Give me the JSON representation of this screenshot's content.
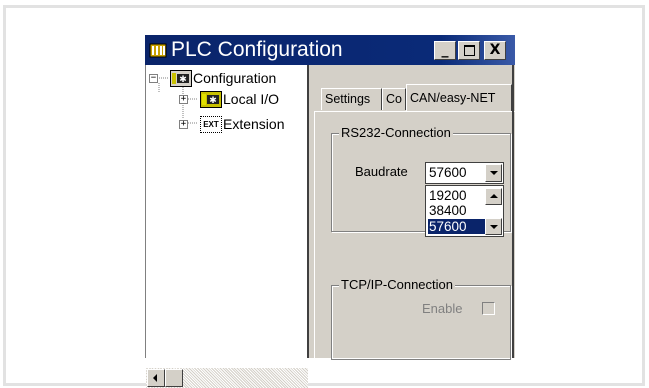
{
  "window": {
    "title": "PLC Configuration",
    "minimize_label": "_",
    "maximize_label": "□",
    "close_label": "X"
  },
  "tree": {
    "items": [
      {
        "label": "Configuration",
        "icon": "configuration-icon",
        "expander": "−"
      },
      {
        "label": "Local I/O",
        "icon": "local-io-icon",
        "expander": "+"
      },
      {
        "label": "Extension",
        "icon": "ext-icon",
        "icon_text": "EXT",
        "expander": "+"
      }
    ]
  },
  "tabs": [
    {
      "label": "Settings"
    },
    {
      "label": "Co"
    },
    {
      "label": "CAN/easy-NET"
    }
  ],
  "rs232": {
    "group_label": "RS232-Connection",
    "baudrate_label": "Baudrate",
    "baudrate_value": "57600",
    "options": [
      "19200",
      "38400",
      "57600"
    ],
    "selected_option": "57600"
  },
  "tcpip": {
    "group_label": "TCP/IP-Connection",
    "enable_label": "Enable",
    "enable_checked": false
  },
  "colors": {
    "titlebar": "#0a246a",
    "selection": "#0a246a",
    "face": "#d4d0c8"
  }
}
